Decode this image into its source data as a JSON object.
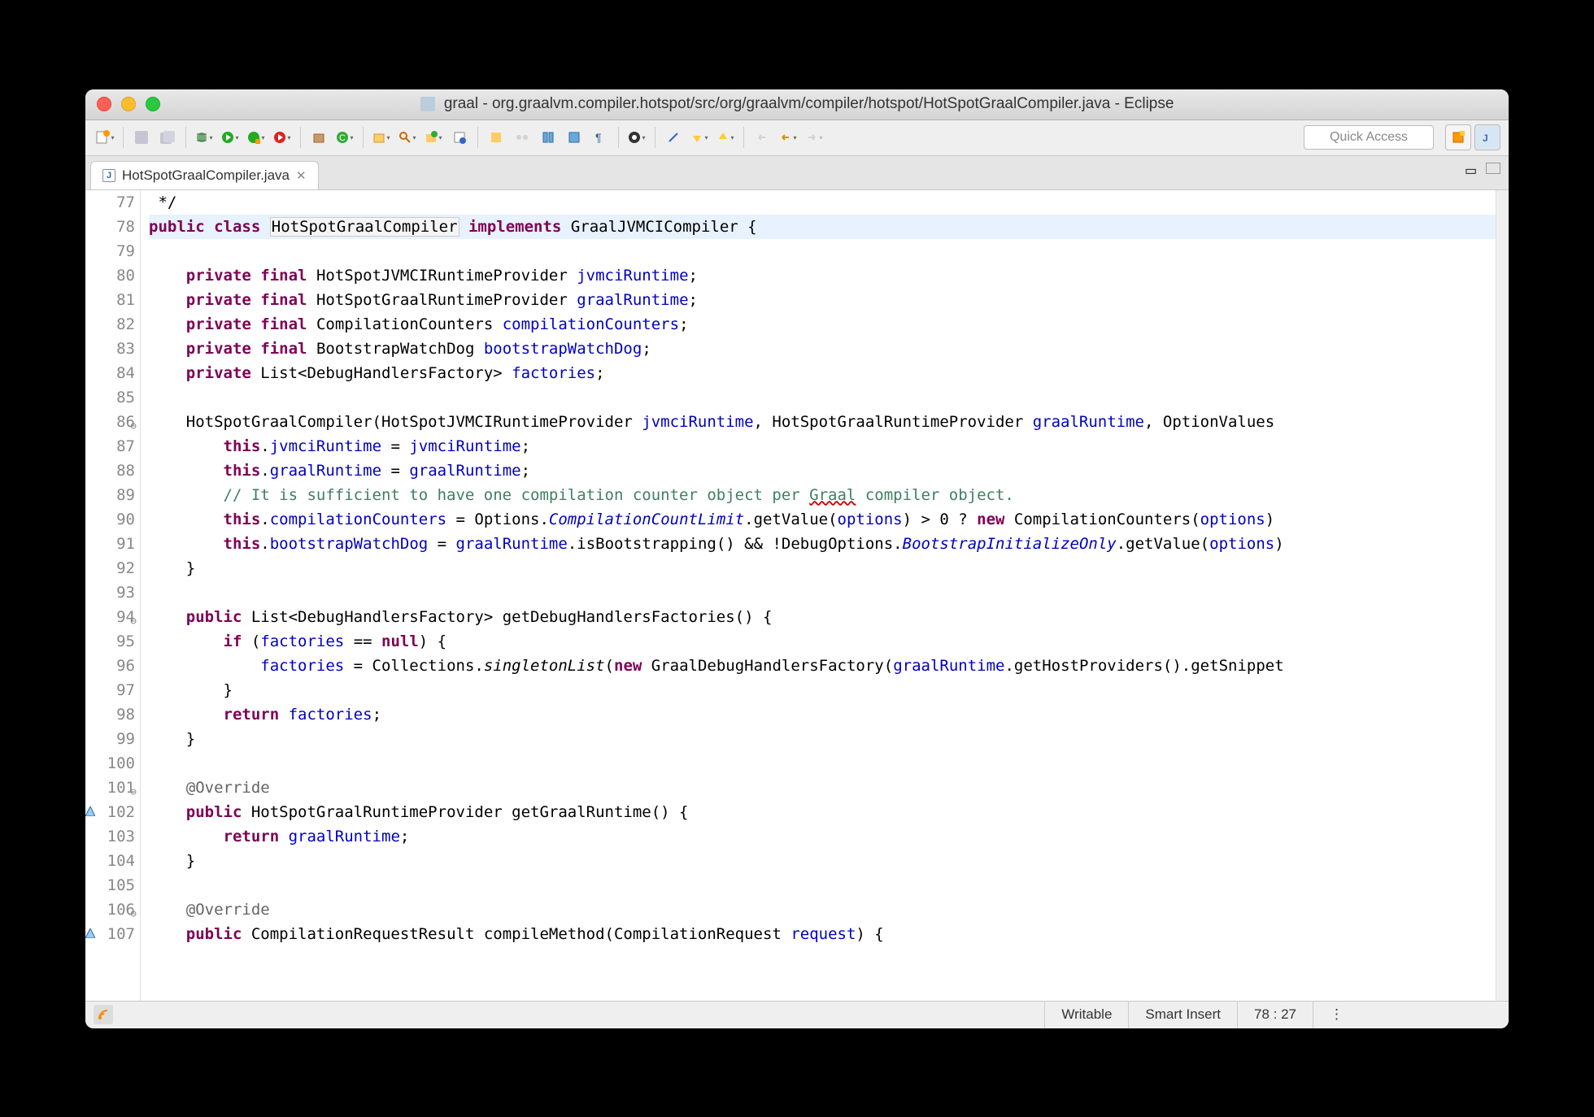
{
  "window": {
    "title": "graal - org.graalvm.compiler.hotspot/src/org/graalvm/compiler/hotspot/HotSpotGraalCompiler.java - Eclipse"
  },
  "toolbar": {
    "quick_access": "Quick Access"
  },
  "tabs": {
    "active": "HotSpotGraalCompiler.java",
    "close": "✕"
  },
  "status": {
    "writable": "Writable",
    "insert_mode": "Smart Insert",
    "cursor": "78 : 27"
  },
  "code": {
    "lines": [
      {
        "n": 77,
        "html": "",
        "pre": " */"
      },
      {
        "n": 78,
        "hl": true,
        "tokens": [
          [
            "kw",
            "public"
          ],
          [
            "",
            " "
          ],
          [
            "kw",
            "class"
          ],
          [
            "",
            " "
          ],
          [
            "boxed",
            "HotSpotGraalCompiler"
          ],
          [
            "",
            " "
          ],
          [
            "kw",
            "implements"
          ],
          [
            "",
            " GraalJVMCICompiler {"
          ]
        ]
      },
      {
        "n": 79,
        "tokens": [
          [
            "",
            ""
          ]
        ]
      },
      {
        "n": 80,
        "tokens": [
          [
            "",
            "    "
          ],
          [
            "kw",
            "private"
          ],
          [
            "",
            " "
          ],
          [
            "kw",
            "final"
          ],
          [
            "",
            " HotSpotJVMCIRuntimeProvider "
          ],
          [
            "fld",
            "jvmciRuntime"
          ],
          [
            "",
            ";"
          ]
        ]
      },
      {
        "n": 81,
        "tokens": [
          [
            "",
            "    "
          ],
          [
            "kw",
            "private"
          ],
          [
            "",
            " "
          ],
          [
            "kw",
            "final"
          ],
          [
            "",
            " HotSpotGraalRuntimeProvider "
          ],
          [
            "fld",
            "graalRuntime"
          ],
          [
            "",
            ";"
          ]
        ]
      },
      {
        "n": 82,
        "tokens": [
          [
            "",
            "    "
          ],
          [
            "kw",
            "private"
          ],
          [
            "",
            " "
          ],
          [
            "kw",
            "final"
          ],
          [
            "",
            " CompilationCounters "
          ],
          [
            "fld",
            "compilationCounters"
          ],
          [
            "",
            ";"
          ]
        ]
      },
      {
        "n": 83,
        "tokens": [
          [
            "",
            "    "
          ],
          [
            "kw",
            "private"
          ],
          [
            "",
            " "
          ],
          [
            "kw",
            "final"
          ],
          [
            "",
            " BootstrapWatchDog "
          ],
          [
            "fld",
            "bootstrapWatchDog"
          ],
          [
            "",
            ";"
          ]
        ]
      },
      {
        "n": 84,
        "tokens": [
          [
            "",
            "    "
          ],
          [
            "kw",
            "private"
          ],
          [
            "",
            " List<DebugHandlersFactory> "
          ],
          [
            "fld",
            "factories"
          ],
          [
            "",
            ";"
          ]
        ]
      },
      {
        "n": 85,
        "tokens": [
          [
            "",
            ""
          ]
        ]
      },
      {
        "n": 86,
        "fold": true,
        "tokens": [
          [
            "",
            "    HotSpotGraalCompiler(HotSpotJVMCIRuntimeProvider "
          ],
          [
            "fld",
            "jvmciRuntime"
          ],
          [
            "",
            ", HotSpotGraalRuntimeProvider "
          ],
          [
            "fld",
            "graalRuntime"
          ],
          [
            "",
            ", OptionValues"
          ]
        ]
      },
      {
        "n": 87,
        "tokens": [
          [
            "",
            "        "
          ],
          [
            "kw",
            "this"
          ],
          [
            "",
            "."
          ],
          [
            "fld",
            "jvmciRuntime"
          ],
          [
            "",
            " = "
          ],
          [
            "fld",
            "jvmciRuntime"
          ],
          [
            "",
            ";"
          ]
        ]
      },
      {
        "n": 88,
        "tokens": [
          [
            "",
            "        "
          ],
          [
            "kw",
            "this"
          ],
          [
            "",
            "."
          ],
          [
            "fld",
            "graalRuntime"
          ],
          [
            "",
            " = "
          ],
          [
            "fld",
            "graalRuntime"
          ],
          [
            "",
            ";"
          ]
        ]
      },
      {
        "n": 89,
        "tokens": [
          [
            "",
            "        "
          ],
          [
            "cmt",
            "// It is sufficient to have one compilation counter object per "
          ],
          [
            "cmt err",
            "Graal"
          ],
          [
            "cmt",
            " compiler object."
          ]
        ]
      },
      {
        "n": 90,
        "tokens": [
          [
            "",
            "        "
          ],
          [
            "kw",
            "this"
          ],
          [
            "",
            "."
          ],
          [
            "fld",
            "compilationCounters"
          ],
          [
            "",
            " = Options."
          ],
          [
            "fld em",
            "CompilationCountLimit"
          ],
          [
            "",
            ".getValue("
          ],
          [
            "fld",
            "options"
          ],
          [
            "",
            ") > 0 ? "
          ],
          [
            "kw",
            "new"
          ],
          [
            "",
            " CompilationCounters("
          ],
          [
            "fld",
            "options"
          ],
          [
            "",
            ")"
          ]
        ]
      },
      {
        "n": 91,
        "tokens": [
          [
            "",
            "        "
          ],
          [
            "kw",
            "this"
          ],
          [
            "",
            "."
          ],
          [
            "fld",
            "bootstrapWatchDog"
          ],
          [
            "",
            " = "
          ],
          [
            "fld",
            "graalRuntime"
          ],
          [
            "",
            ".isBootstrapping() && !DebugOptions."
          ],
          [
            "fld em",
            "BootstrapInitializeOnly"
          ],
          [
            "",
            ".getValue("
          ],
          [
            "fld",
            "options"
          ],
          [
            "",
            ")"
          ]
        ]
      },
      {
        "n": 92,
        "tokens": [
          [
            "",
            "    }"
          ]
        ]
      },
      {
        "n": 93,
        "tokens": [
          [
            "",
            ""
          ]
        ]
      },
      {
        "n": 94,
        "fold": true,
        "tokens": [
          [
            "",
            "    "
          ],
          [
            "kw",
            "public"
          ],
          [
            "",
            " List<DebugHandlersFactory> getDebugHandlersFactories() {"
          ]
        ]
      },
      {
        "n": 95,
        "tokens": [
          [
            "",
            "        "
          ],
          [
            "kw",
            "if"
          ],
          [
            "",
            " ("
          ],
          [
            "fld",
            "factories"
          ],
          [
            "",
            " == "
          ],
          [
            "kw",
            "null"
          ],
          [
            "",
            ") {"
          ]
        ]
      },
      {
        "n": 96,
        "tokens": [
          [
            "",
            "            "
          ],
          [
            "fld",
            "factories"
          ],
          [
            "",
            " = Collections."
          ],
          [
            "em",
            "singletonList"
          ],
          [
            "",
            "("
          ],
          [
            "kw",
            "new"
          ],
          [
            "",
            " GraalDebugHandlersFactory("
          ],
          [
            "fld",
            "graalRuntime"
          ],
          [
            "",
            ".getHostProviders().getSnippet"
          ]
        ]
      },
      {
        "n": 97,
        "tokens": [
          [
            "",
            "        }"
          ]
        ]
      },
      {
        "n": 98,
        "tokens": [
          [
            "",
            "        "
          ],
          [
            "kw",
            "return"
          ],
          [
            "",
            " "
          ],
          [
            "fld",
            "factories"
          ],
          [
            "",
            ";"
          ]
        ]
      },
      {
        "n": 99,
        "tokens": [
          [
            "",
            "    }"
          ]
        ]
      },
      {
        "n": 100,
        "tokens": [
          [
            "",
            ""
          ]
        ]
      },
      {
        "n": 101,
        "fold": true,
        "tokens": [
          [
            "",
            "    "
          ],
          [
            "ann",
            "@Override"
          ]
        ]
      },
      {
        "n": 102,
        "marker": "override",
        "tokens": [
          [
            "",
            "    "
          ],
          [
            "kw",
            "public"
          ],
          [
            "",
            " HotSpotGraalRuntimeProvider getGraalRuntime() {"
          ]
        ]
      },
      {
        "n": 103,
        "tokens": [
          [
            "",
            "        "
          ],
          [
            "kw",
            "return"
          ],
          [
            "",
            " "
          ],
          [
            "fld",
            "graalRuntime"
          ],
          [
            "",
            ";"
          ]
        ]
      },
      {
        "n": 104,
        "tokens": [
          [
            "",
            "    }"
          ]
        ]
      },
      {
        "n": 105,
        "tokens": [
          [
            "",
            ""
          ]
        ]
      },
      {
        "n": 106,
        "fold": true,
        "tokens": [
          [
            "",
            "    "
          ],
          [
            "ann",
            "@Override"
          ]
        ]
      },
      {
        "n": 107,
        "marker": "override",
        "tokens": [
          [
            "",
            "    "
          ],
          [
            "kw",
            "public"
          ],
          [
            "",
            " CompilationRequestResult compileMethod(CompilationRequest "
          ],
          [
            "fld",
            "request"
          ],
          [
            "",
            ") {"
          ]
        ]
      }
    ]
  }
}
